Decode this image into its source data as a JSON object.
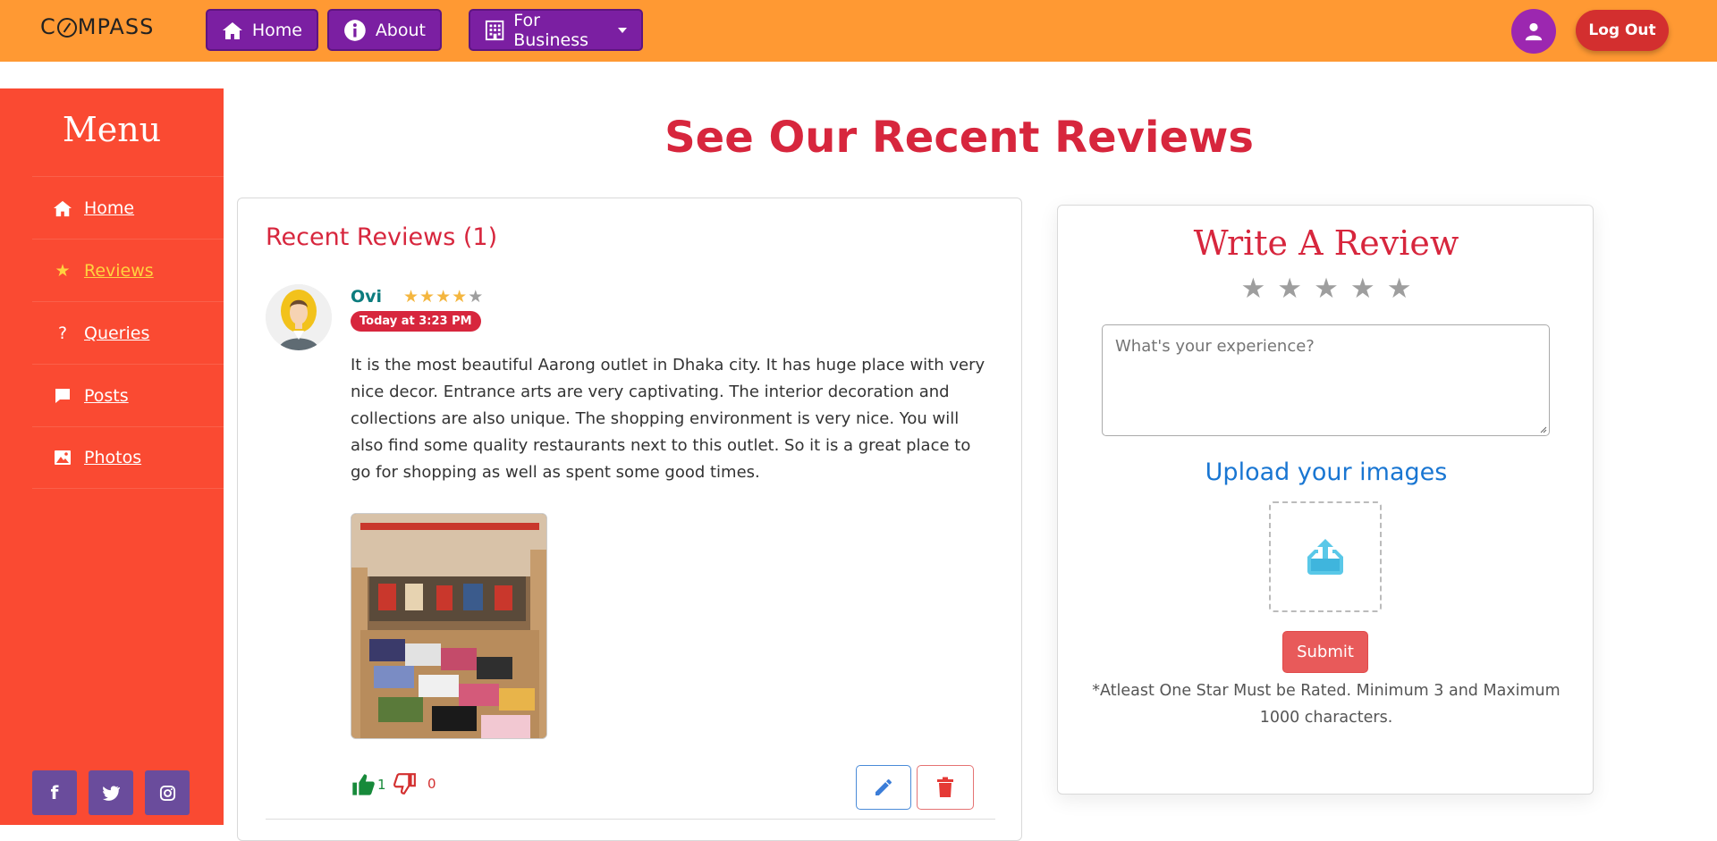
{
  "navbar": {
    "brand_prefix": "C",
    "brand_suffix": "MPASS",
    "home_label": "Home",
    "about_label": "About",
    "business_label": "For Business",
    "logout_label": "Log Out",
    "bg_color": "#ff9933",
    "button_color": "#7b1fa2"
  },
  "sidebar": {
    "title": "Menu",
    "bg_color": "#fa4a32",
    "items": [
      {
        "label": "Home",
        "icon": "home-icon",
        "active": false
      },
      {
        "label": "Reviews",
        "icon": "star-icon",
        "active": true
      },
      {
        "label": "Queries",
        "icon": "question-icon",
        "active": false
      },
      {
        "label": "Posts",
        "icon": "comment-icon",
        "active": false
      },
      {
        "label": "Photos",
        "icon": "image-icon",
        "active": false
      }
    ],
    "socials": [
      {
        "label": "f",
        "icon": "facebook-icon"
      },
      {
        "label": "twitter",
        "icon": "twitter-icon"
      },
      {
        "label": "instagram",
        "icon": "instagram-icon"
      }
    ]
  },
  "main": {
    "title": "See Our Recent Reviews"
  },
  "reviews": {
    "heading": "Recent Reviews (1)",
    "items": [
      {
        "author": "Ovi",
        "rating": 4,
        "max_rating": 5,
        "time": "Today at 3:23 PM",
        "text": "It is the most beautiful Aarong outlet in Dhaka city. It has huge place with very nice decor. Entrance arts are very captivating. The interior decoration and collections are also unique. The shopping environment is very nice. You will also find some quality restaurants next to this outlet. So it is a great place to go for shopping as well as spent some good times.",
        "likes": "1",
        "dislikes": "0"
      }
    ]
  },
  "write_review": {
    "title": "Write A Review",
    "star_count": 5,
    "placeholder": "What's your experience?",
    "upload_title": "Upload your images",
    "submit_label": "Submit",
    "hint": "*Atleast One Star Must be Rated. Minimum 3 and Maximum 1000 characters."
  }
}
